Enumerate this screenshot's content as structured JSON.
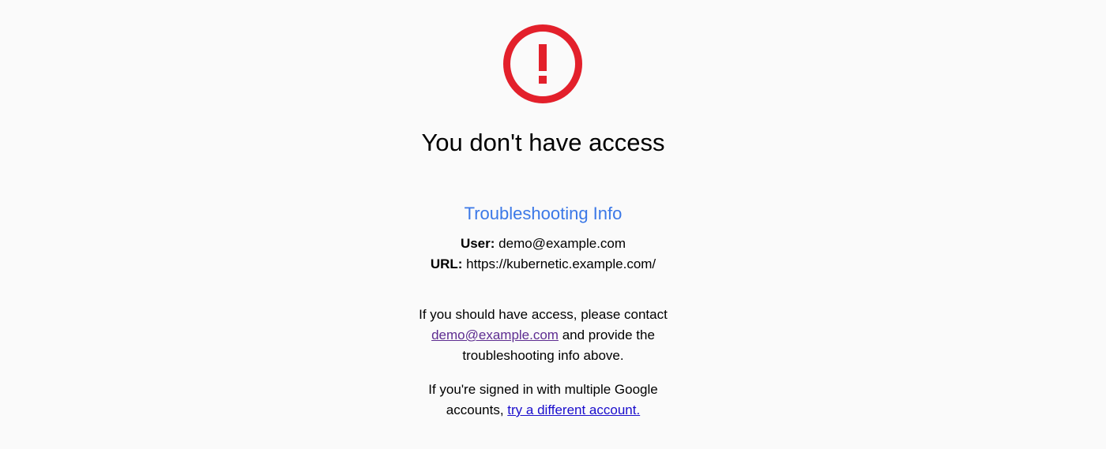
{
  "icon": {
    "name": "error-icon",
    "color": "#e3202b"
  },
  "heading": "You don't have access",
  "troubleshooting": {
    "title": "Troubleshooting Info",
    "user_label": "User:",
    "user_value": "demo@example.com",
    "url_label": "URL:",
    "url_value": "https://kubernetic.example.com/"
  },
  "contact": {
    "line1": "If you should have access, please contact",
    "email_link": "demo@example.com",
    "line2_rest": " and provide the",
    "line3": "troubleshooting info above."
  },
  "multi_account": {
    "line1": "If you're signed in with multiple Google",
    "line2_prefix": "accounts, ",
    "link_text": "try a different account."
  },
  "colors": {
    "background": "#fafafa",
    "accent_blue": "#3b78e7",
    "visited_link": "#5e2d91",
    "link": "#1a0dcc",
    "error_red": "#e3202b"
  }
}
